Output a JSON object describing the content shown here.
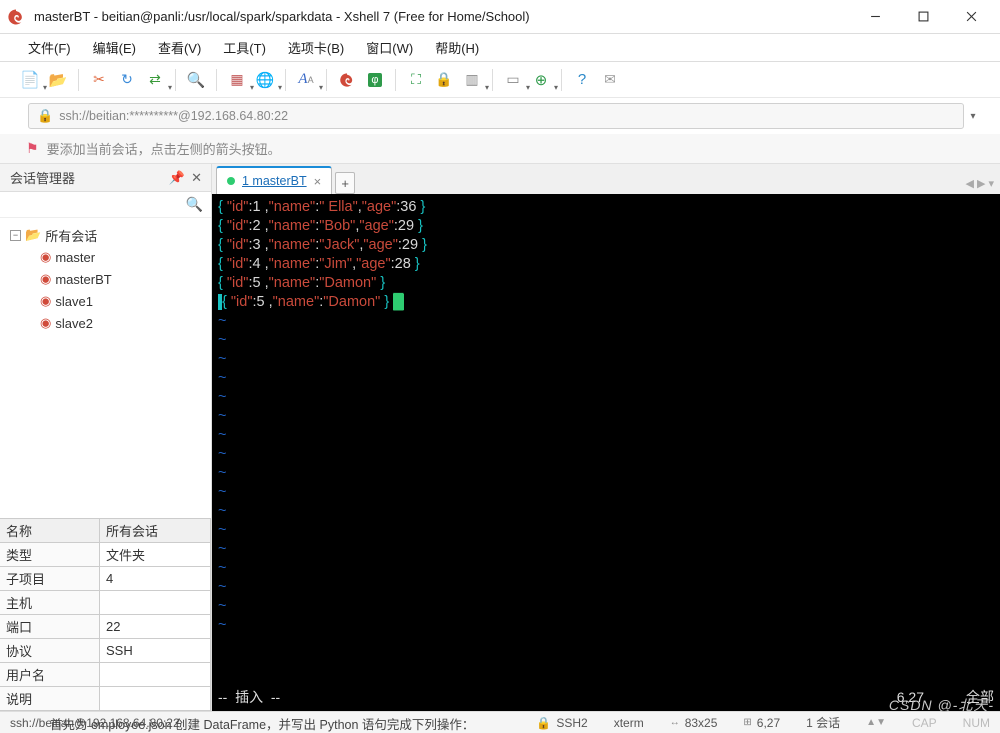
{
  "window": {
    "title": "masterBT - beitian@panli:/usr/local/spark/sparkdata - Xshell 7 (Free for Home/School)"
  },
  "menu": {
    "file": "文件(F)",
    "edit": "编辑(E)",
    "view": "查看(V)",
    "tools": "工具(T)",
    "tabs": "选项卡(B)",
    "window": "窗口(W)",
    "help": "帮助(H)"
  },
  "address": {
    "url": "ssh://beitian:**********@192.168.64.80:22"
  },
  "hint": {
    "text": "要添加当前会话，点击左侧的箭头按钮。"
  },
  "sidebar": {
    "title": "会话管理器",
    "root": "所有会话",
    "items": [
      "master",
      "masterBT",
      "slave1",
      "slave2"
    ]
  },
  "props": {
    "hdr_name": "名称",
    "hdr_val": "所有会话",
    "rows": [
      {
        "k": "类型",
        "v": "文件夹"
      },
      {
        "k": "子项目",
        "v": "4"
      },
      {
        "k": "主机",
        "v": ""
      },
      {
        "k": "端口",
        "v": "22"
      },
      {
        "k": "协议",
        "v": "SSH"
      },
      {
        "k": "用户名",
        "v": ""
      },
      {
        "k": "说明",
        "v": ""
      }
    ]
  },
  "tab": {
    "label": "1 masterBT",
    "add": "+"
  },
  "terminal": {
    "lines": [
      {
        "id": 1,
        "name": " Ella",
        "age": 36,
        "full": true
      },
      {
        "id": 2,
        "name": "Bob",
        "age": 29,
        "full": true
      },
      {
        "id": 3,
        "name": "Jack",
        "age": 29,
        "full": true
      },
      {
        "id": 4,
        "name": "Jim",
        "age": 28,
        "full": true
      },
      {
        "id": 5,
        "name": "Damon",
        "full": false
      },
      {
        "id": 5,
        "name": "Damon",
        "full": false,
        "cursor": true,
        "lead": true
      }
    ],
    "mode": "--  插入  --",
    "pos": "6,27",
    "scope": "全部"
  },
  "status": {
    "conn": "ssh://beitian@192.168.64.80:22",
    "proto": "SSH2",
    "term": "xterm",
    "size": "83x25",
    "cursor": "6,27",
    "sessions": "1 会话",
    "cap": "CAP",
    "num": "NUM"
  },
  "watermark": "CSDN @-北天-",
  "cutline": "首先为 employee.json 创建 DataFrame，并写出 Python 语句完成下列操作："
}
